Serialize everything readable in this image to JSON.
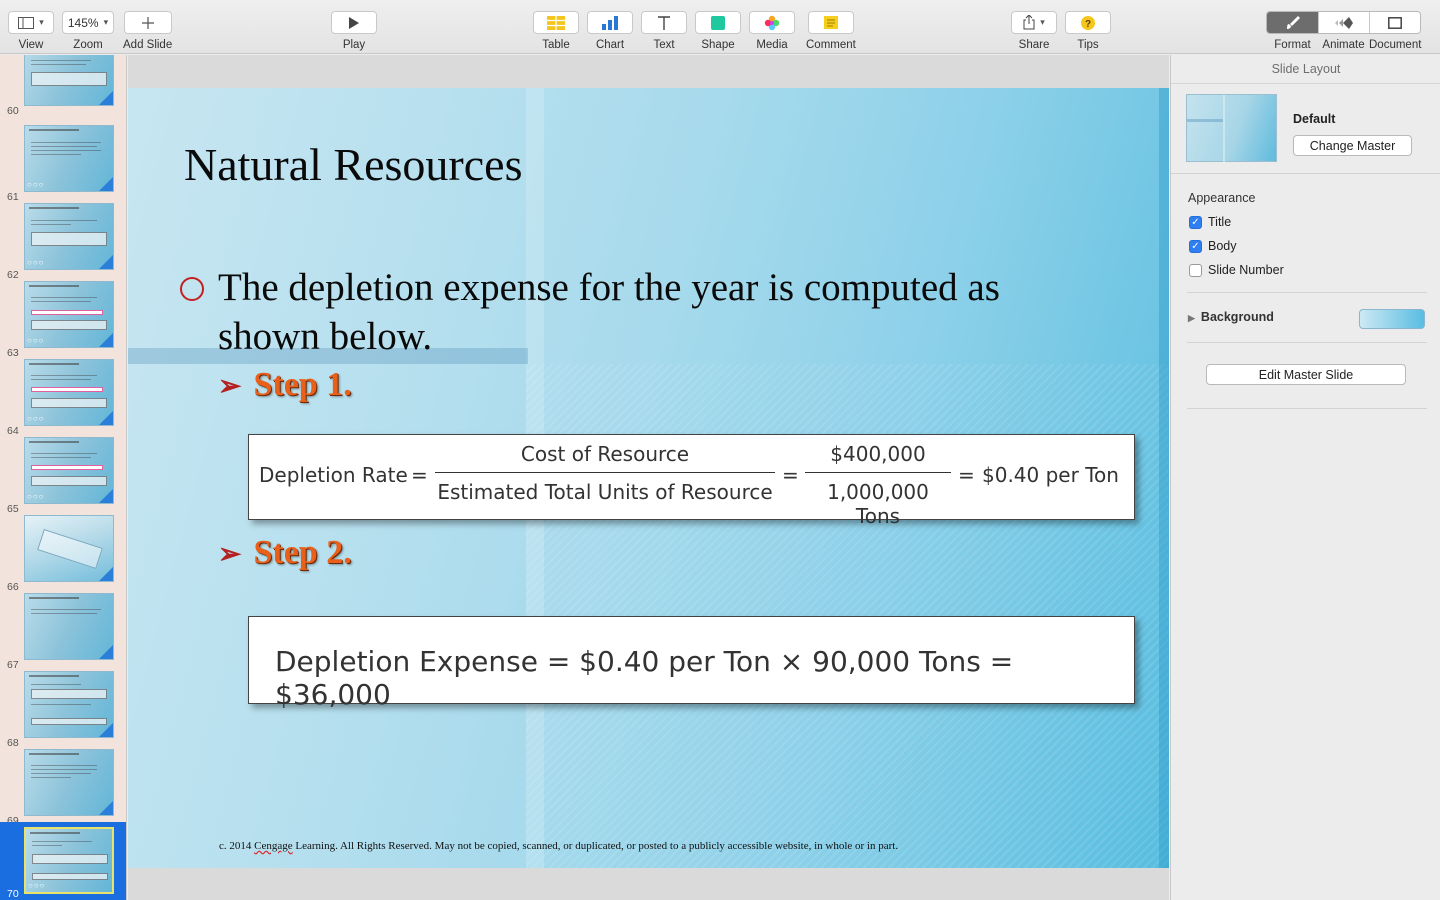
{
  "toolbar": {
    "view_label": "View",
    "zoom_value": "145%",
    "zoom_label": "Zoom",
    "add_slide_label": "Add Slide",
    "play_label": "Play",
    "table_label": "Table",
    "chart_label": "Chart",
    "text_label": "Text",
    "shape_label": "Shape",
    "media_label": "Media",
    "comment_label": "Comment",
    "share_label": "Share",
    "tips_label": "Tips",
    "format_label": "Format",
    "animate_label": "Animate",
    "document_label": "Document"
  },
  "navigator": {
    "slides": [
      {
        "number": "60"
      },
      {
        "number": "61"
      },
      {
        "number": "62"
      },
      {
        "number": "63"
      },
      {
        "number": "64"
      },
      {
        "number": "65"
      },
      {
        "number": "66"
      },
      {
        "number": "67"
      },
      {
        "number": "68"
      },
      {
        "number": "69"
      },
      {
        "number": "70"
      }
    ],
    "selected_slide": "70"
  },
  "slide": {
    "title": "Natural Resources",
    "bullet": "The depletion expense for the year is computed as shown below.",
    "step1": "Step 1.",
    "step2": "Step 2.",
    "formula1": {
      "label": "Depletion Rate",
      "eq": "=",
      "frac1_num": "Cost of Resource",
      "frac1_den": "Estimated Total Units of Resource",
      "frac2_num": "$400,000",
      "frac2_den": "1,000,000 Tons",
      "result": "$0.40 per Ton"
    },
    "formula2": "Depletion Expense = $0.40 per Ton × 90,000 Tons = $36,000",
    "copyright_pre": "c. 2014 ",
    "copyright_brand": "Cengage",
    "copyright_post": " Learning.   All Rights Reserved.  May not be copied, scanned, or duplicated, or posted to a publicly accessible website, in whole or in part."
  },
  "inspector": {
    "title": "Slide Layout",
    "master_name": "Default",
    "change_master": "Change Master",
    "appearance": "Appearance",
    "options": [
      {
        "label": "Title",
        "checked": true
      },
      {
        "label": "Body",
        "checked": true
      },
      {
        "label": "Slide Number",
        "checked": false
      }
    ],
    "background_label": "Background",
    "edit_master": "Edit Master Slide"
  },
  "colors": {
    "accent": "#2f7ff2",
    "selection": "#1a6ee0",
    "step_text": "#e8601a",
    "bullet_ring": "#c42020"
  }
}
